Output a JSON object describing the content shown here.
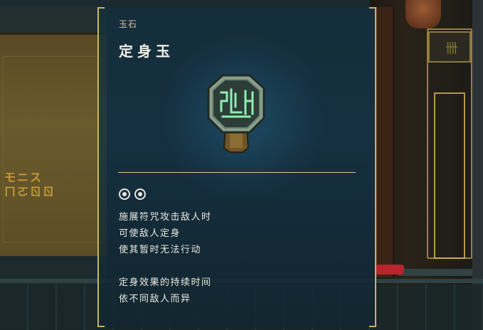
{
  "item": {
    "category": "玉石",
    "name": "定身玉",
    "icon": "jade-seal-icon",
    "cost_pips": 2,
    "description_lines": [
      "施展符咒攻击敌人时",
      "可使敌人定身",
      "使其暂时无法行动"
    ],
    "note_lines": [
      "定身效果的持续时间",
      "依不同敌人而异"
    ]
  },
  "scene": {
    "left_sign_lines": [
      "モニス",
      "ㄇㄛㄖㄖ"
    ]
  },
  "colors": {
    "accent_gold": "#c9b26a",
    "text_light": "#eceae2",
    "jade_green": "#7fd9a0"
  }
}
